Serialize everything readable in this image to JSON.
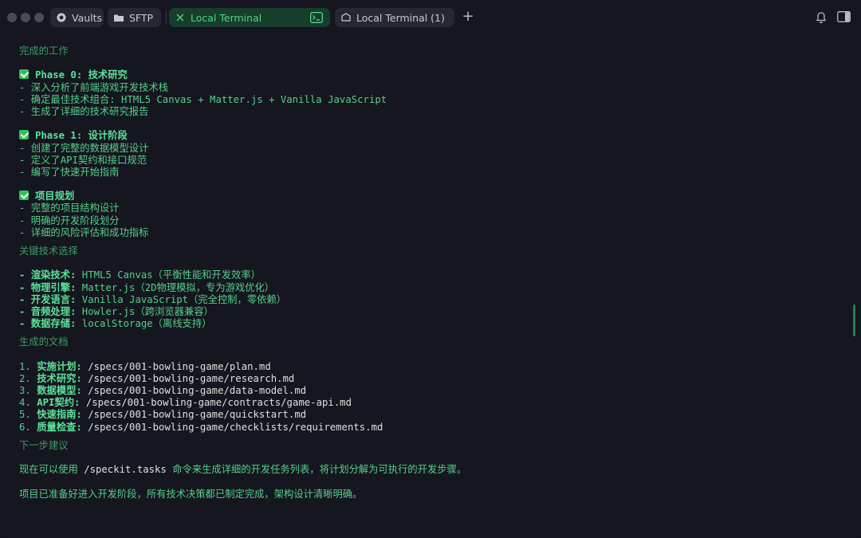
{
  "tabs": [
    {
      "label": "Vaults",
      "icon": "vault-icon"
    },
    {
      "label": "SFTP",
      "icon": "folder-icon"
    },
    {
      "label": "Local Terminal",
      "icon": "close-icon",
      "active": true
    },
    {
      "label": "Local Terminal (1)",
      "icon": "terminal-icon"
    }
  ],
  "colors": {
    "accent": "#50d48c",
    "background": "#15161f",
    "active_tab": "#173d2c"
  },
  "terminal": {
    "section_done": "完成的工作",
    "phase0": {
      "title": "Phase 0: 技术研究",
      "items": [
        "- 深入分析了前端游戏开发技术栈",
        "- 确定最佳技术组合: HTML5 Canvas + Matter.js + Vanilla JavaScript",
        "- 生成了详细的技术研究报告"
      ]
    },
    "phase1": {
      "title": "Phase 1: 设计阶段",
      "items": [
        "- 创建了完整的数据模型设计",
        "- 定义了API契约和接口规范",
        "- 编写了快速开始指南"
      ]
    },
    "planning": {
      "title": "项目规划",
      "items": [
        "- 完整的项目结构设计",
        "- 明确的开发阶段划分",
        "- 详细的风险评估和成功指标"
      ]
    },
    "section_tech": "关键技术选择",
    "tech": [
      {
        "key": "- 渲染技术:",
        "value": " HTML5 Canvas（平衡性能和开发效率）"
      },
      {
        "key": "- 物理引擎:",
        "value": " Matter.js（2D物理模拟，专为游戏优化）"
      },
      {
        "key": "- 开发语言:",
        "value": " Vanilla JavaScript（完全控制，零依赖）"
      },
      {
        "key": "- 音频处理:",
        "value": " Howler.js（跨浏览器兼容）"
      },
      {
        "key": "- 数据存储:",
        "value": " localStorage（离线支持）"
      }
    ],
    "section_docs": "生成的文档",
    "docs": [
      {
        "num": "1. ",
        "key": "实施计划:",
        "path": " /specs/001-bowling-game/plan.md"
      },
      {
        "num": "2. ",
        "key": "技术研究:",
        "path": " /specs/001-bowling-game/research.md"
      },
      {
        "num": "3. ",
        "key": "数据模型:",
        "path": " /specs/001-bowling-game/data-model.md"
      },
      {
        "num": "4. ",
        "key": "API契约:",
        "path": " /specs/001-bowling-game/contracts/game-api.md"
      },
      {
        "num": "5. ",
        "key": "快速指南:",
        "path": " /specs/001-bowling-game/quickstart.md"
      },
      {
        "num": "6. ",
        "key": "质量检查:",
        "path": " /specs/001-bowling-game/checklists/requirements.md"
      }
    ],
    "section_next": "下一步建议",
    "next_pre": "现在可以使用 ",
    "next_cmd": "/speckit.tasks",
    "next_post": " 命令来生成详细的开发任务列表，将计划分解为可执行的开发步骤。",
    "final": "项目已准备好进入开发阶段，所有技术决策都已制定完成，架构设计清晰明确。"
  }
}
